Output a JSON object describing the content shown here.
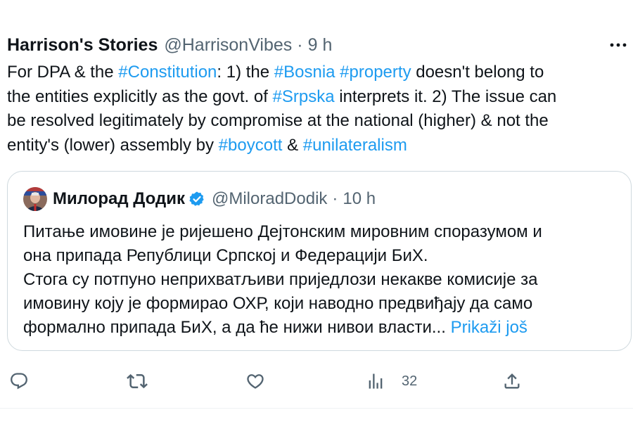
{
  "tweet": {
    "author_name": "Harrison's Stories",
    "author_handle": "@HarrisonVibes",
    "separator": "·",
    "time": "9 h",
    "lines": [
      [
        {
          "t": "For DPA & the "
        },
        {
          "t": "#Constitution",
          "tag": true
        },
        {
          "t": ": 1) the "
        },
        {
          "t": "#Bosnia",
          "tag": true
        },
        {
          "t": " "
        },
        {
          "t": "#property",
          "tag": true
        },
        {
          "t": " doesn't belong to"
        }
      ],
      [
        {
          "t": "the entities explicitly as the govt. of "
        },
        {
          "t": "#Srpska",
          "tag": true
        },
        {
          "t": " interprets it. 2) The issue can"
        }
      ],
      [
        {
          "t": "be resolved legitimately by compromise at the national (higher) & not the"
        }
      ],
      [
        {
          "t": "entity's (lower) assembly by "
        },
        {
          "t": "#boycott",
          "tag": true
        },
        {
          "t": " & "
        },
        {
          "t": "#unilateralism",
          "tag": true
        }
      ]
    ]
  },
  "quote": {
    "author_name": "Милорад Додик",
    "author_handle": "@MiloradDodik",
    "separator": "·",
    "time": "10 h",
    "lines": [
      "Питање имовине је ријешено Дејтонским мировним споразумом и",
      "она припада Републици Српској и Федерацији БиХ.",
      "Стога су потпуно неприхватљиви приједлози некакве комисије за",
      "имовину коју је формирао ОХР, који наводно предвиђају да само",
      "формално припада БиХ, а да ће нижи нивои власти..."
    ],
    "show_more": "Prikaži još"
  },
  "actions": {
    "views_count": "32"
  },
  "icons": {
    "more": "more-dots-icon",
    "reply": "reply-icon",
    "retweet": "retweet-icon",
    "like": "heart-icon",
    "views": "views-chart-icon",
    "share": "share-icon",
    "verified": "verified-badge-icon"
  },
  "colors": {
    "text": "#0f1419",
    "secondary": "#536471",
    "link": "#1d9bf0",
    "verified": "#1d9bf0",
    "border": "#cfd9de"
  }
}
